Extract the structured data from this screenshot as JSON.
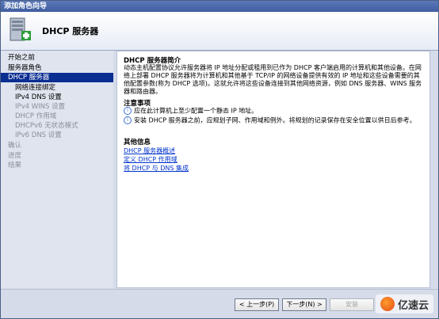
{
  "window": {
    "title": "添加角色向导"
  },
  "header": {
    "title": "DHCP 服务器"
  },
  "sidebar": {
    "items": [
      {
        "label": "开始之前",
        "state": "normal",
        "indent": 0
      },
      {
        "label": "服务器角色",
        "state": "normal",
        "indent": 0
      },
      {
        "label": "DHCP 服务器",
        "state": "selected",
        "indent": 0
      },
      {
        "label": "网络连接绑定",
        "state": "normal",
        "indent": 1
      },
      {
        "label": "IPv4 DNS 设置",
        "state": "normal",
        "indent": 1
      },
      {
        "label": "IPv4 WINS 设置",
        "state": "disabled",
        "indent": 1
      },
      {
        "label": "DHCP 作用域",
        "state": "disabled",
        "indent": 1
      },
      {
        "label": "DHCPv6 无状态模式",
        "state": "disabled",
        "indent": 1
      },
      {
        "label": "IPv6 DNS 设置",
        "state": "disabled",
        "indent": 1
      },
      {
        "label": "确认",
        "state": "disabled",
        "indent": 0
      },
      {
        "label": "进度",
        "state": "disabled",
        "indent": 0
      },
      {
        "label": "结果",
        "state": "disabled",
        "indent": 0
      }
    ]
  },
  "content": {
    "intro_title": "DHCP 服务器简介",
    "intro_text": "动态主机配置协议允许服务器将 IP 地址分配或租用到已作为 DHCP 客户端启用的计算机和其他设备。在网络上部署 DHCP 服务器将为计算机和其他基于 TCP/IP 的网络设备提供有效的 IP 地址和这些设备需要的其他配置参数(称为 DHCP 选项)。这就允许将这些设备连接到其他网络资源，例如 DNS 服务器、WINS 服务器和路由器。",
    "notes_title": "注意事项",
    "note1": "应在此计算机上至少配置一个静态 IP 地址。",
    "note2": "安装 DHCP 服务器之前，应规划子网、作用域和例外。将规划的记录保存在安全位置以供日后参考。",
    "more_title": "其他信息",
    "link1": "DHCP 服务器概述",
    "link2": "定义 DHCP 作用域",
    "link3": "将 DHCP 与 DNS 集成"
  },
  "footer": {
    "prev_label": "< 上一步(P)",
    "next_label": "下一步(N) >",
    "install_label": "安装"
  },
  "watermark": {
    "text": "亿速云"
  }
}
